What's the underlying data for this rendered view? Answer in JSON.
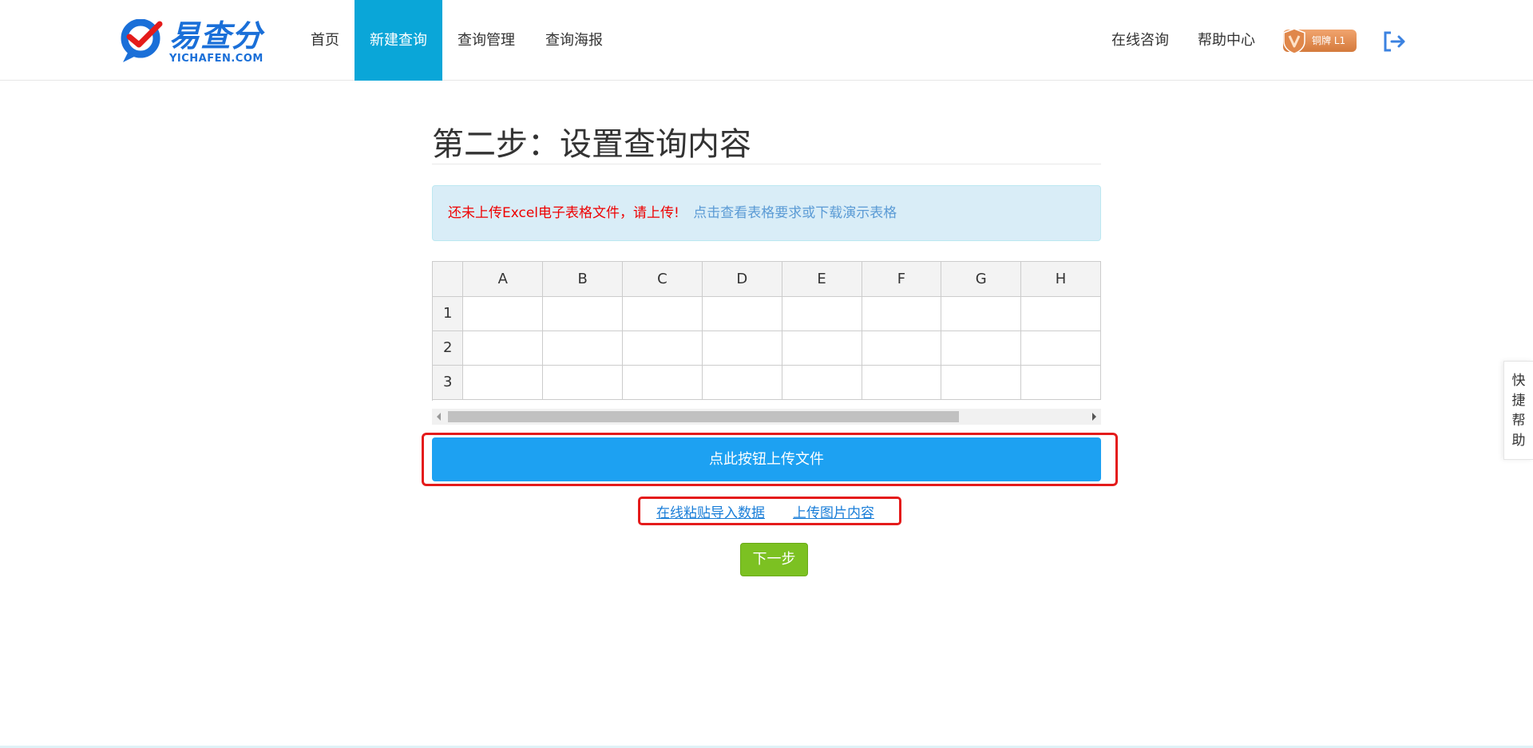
{
  "brand": {
    "name": "易查分",
    "domain": "YICHAFEN.COM",
    "primary_color": "#1a6fd8"
  },
  "nav": {
    "items": [
      {
        "label": "首页",
        "active": false
      },
      {
        "label": "新建查询",
        "active": true
      },
      {
        "label": "查询管理",
        "active": false
      },
      {
        "label": "查询海报",
        "active": false
      }
    ],
    "active_color": "#0aa6d8"
  },
  "header_right": {
    "consult": "在线咨询",
    "help": "帮助中心",
    "badge": {
      "label": "铜牌 L1",
      "icon": "bronze-shield-icon"
    },
    "logout_icon": "logout-icon"
  },
  "page": {
    "title": "第二步：设置查询内容"
  },
  "alert": {
    "warning": "还未上传Excel电子表格文件，请上传!",
    "link": "点击查看表格要求或下载演示表格"
  },
  "sheet": {
    "columns": [
      "A",
      "B",
      "C",
      "D",
      "E",
      "F",
      "G",
      "H"
    ],
    "rows": [
      "1",
      "2",
      "3"
    ]
  },
  "actions": {
    "upload": "点此按钮上传文件",
    "paste": "在线粘贴导入数据",
    "image": "上传图片内容",
    "next": "下一步"
  },
  "side_help": {
    "chars": [
      "快",
      "捷",
      "帮",
      "助"
    ]
  }
}
